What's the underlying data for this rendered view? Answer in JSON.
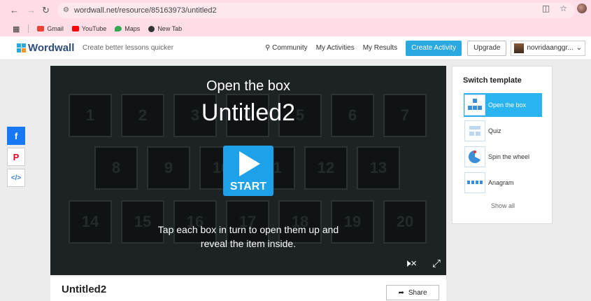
{
  "browser": {
    "url": "wordwall.net/resource/85163973/untitled2",
    "bookmarks": [
      {
        "label": "Gmail",
        "color": "#ea4335"
      },
      {
        "label": "YouTube",
        "color": "#ff0000"
      },
      {
        "label": "Maps",
        "color": "#34a853"
      },
      {
        "label": "New Tab",
        "color": "#333333"
      }
    ]
  },
  "header": {
    "logo": "Wordwall",
    "tagline": "Create better lessons quicker",
    "community": "Community",
    "my_activities": "My Activities",
    "my_results": "My Results",
    "create_activity": "Create Activity",
    "upgrade": "Upgrade",
    "username": "novridaanggr..."
  },
  "game": {
    "template_title": "Open the box",
    "activity_name": "Untitled2",
    "start_label": "START",
    "description": "Tap each box in turn to open them up and reveal the item inside.",
    "tiles": [
      "1",
      "2",
      "3",
      "4",
      "5",
      "6",
      "7",
      "8",
      "9",
      "10",
      "11",
      "12",
      "13",
      "14",
      "15",
      "16",
      "17",
      "18",
      "19",
      "20"
    ],
    "controls": {
      "mute": "mute-icon",
      "fullscreen": "fullscreen-icon"
    }
  },
  "social": {
    "facebook": "f",
    "pinterest": "P",
    "embed": "</>"
  },
  "sidebar": {
    "title": "Switch template",
    "templates": [
      {
        "label": "Open the box",
        "icon": "open-box-icon",
        "active": true
      },
      {
        "label": "Quiz",
        "icon": "quiz-icon",
        "active": false
      },
      {
        "label": "Spin the wheel",
        "icon": "wheel-icon",
        "active": false
      },
      {
        "label": "Anagram",
        "icon": "anagram-icon",
        "active": false
      }
    ],
    "show_all": "Show all"
  },
  "activity": {
    "title": "Untitled2",
    "share_label": "Share"
  },
  "colors": {
    "accent": "#29a9e0",
    "game_bg": "#1d2224",
    "chrome_pink": "#ffdde6"
  }
}
